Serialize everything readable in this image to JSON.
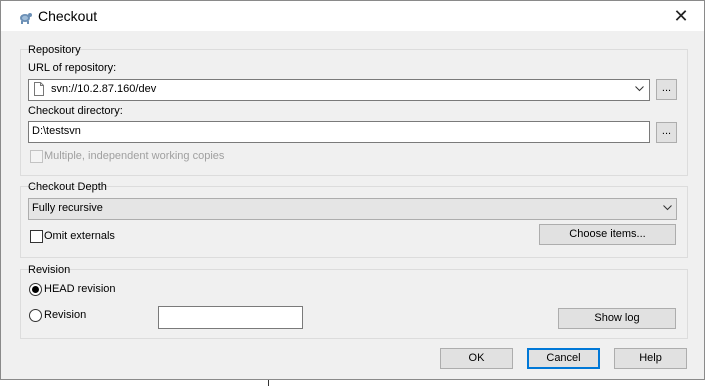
{
  "window": {
    "title": "Checkout",
    "close_glyph": "✕"
  },
  "repository": {
    "group_label": "Repository",
    "url_label": "URL of repository:",
    "url_value": "svn://10.2.87.160/dev",
    "browse_label": "...",
    "dir_label": "Checkout directory:",
    "dir_value": "D:\\testsvn",
    "dir_browse_label": "...",
    "multiple_label": "Multiple, independent working copies",
    "multiple_checked": false
  },
  "depth": {
    "group_label": "Checkout Depth",
    "selected": "Fully recursive",
    "omit_label": "Omit externals",
    "omit_checked": false,
    "choose_items_label": "Choose items..."
  },
  "revision": {
    "group_label": "Revision",
    "head_label": "HEAD revision",
    "head_selected": true,
    "revision_label": "Revision",
    "revision_value": "",
    "show_log_label": "Show log"
  },
  "buttons": {
    "ok": "OK",
    "cancel": "Cancel",
    "help": "Help"
  },
  "icons": {
    "app": "tortoise-svn-icon",
    "close": "close-icon",
    "file": "document-icon",
    "dropdown": "chevron-down-icon"
  },
  "colors": {
    "dialog_bg": "#f0f0f0",
    "focus_border": "#0078d7",
    "button_bg": "#e1e1e1"
  }
}
